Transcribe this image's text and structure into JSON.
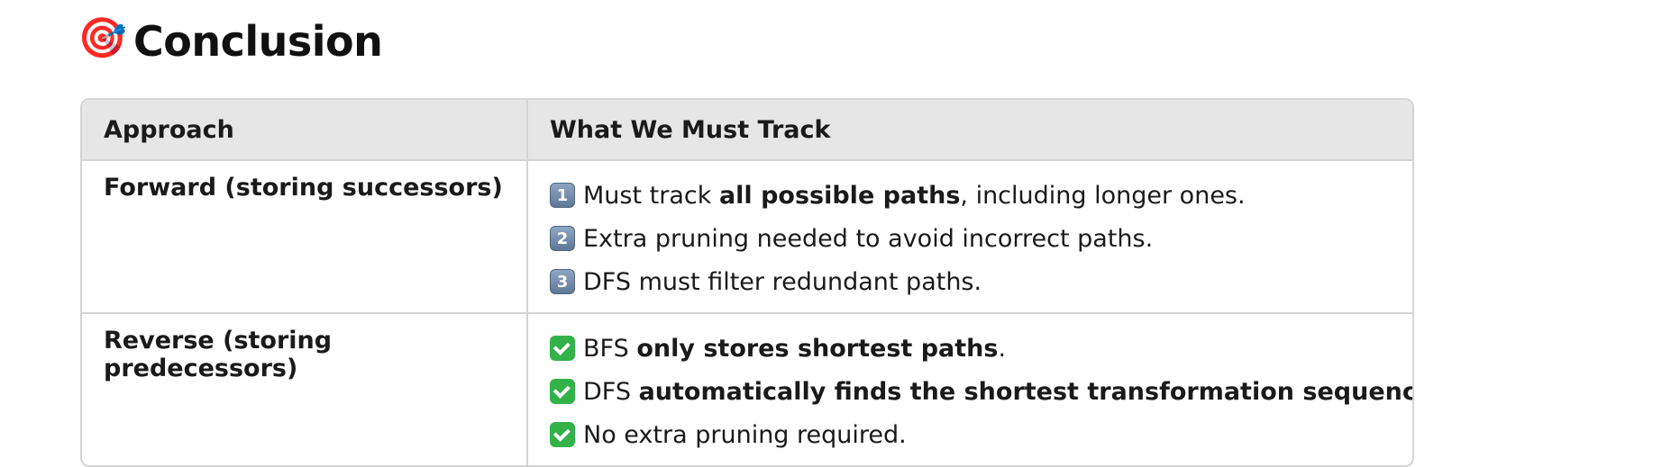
{
  "heading": {
    "icon": "direct-hit-target-icon",
    "emoji": "🎯",
    "title": "Conclusion"
  },
  "table": {
    "headers": [
      "Approach",
      "What We Must Track"
    ],
    "rows": [
      {
        "approach": "Forward (storing successors)",
        "items": [
          {
            "marker": "1",
            "pre": "Must track ",
            "bold": "all possible paths",
            "post": ", including longer ones."
          },
          {
            "marker": "2",
            "pre": "Extra pruning needed to avoid incorrect paths.",
            "bold": "",
            "post": ""
          },
          {
            "marker": "3",
            "pre": "DFS must filter redundant paths.",
            "bold": "",
            "post": ""
          }
        ]
      },
      {
        "approach": "Reverse (storing predecessors)",
        "items": [
          {
            "marker": "check",
            "pre": "BFS ",
            "bold": "only stores shortest paths",
            "post": "."
          },
          {
            "marker": "check",
            "pre": "DFS ",
            "bold": "automatically finds the shortest transformation sequences",
            "post": "."
          },
          {
            "marker": "check",
            "pre": "No extra pruning required.",
            "bold": "",
            "post": ""
          }
        ]
      }
    ]
  },
  "colors": {
    "header_bg": "#e6e6e6",
    "border": "#d4d4d4",
    "number_badge": "#6f87a6",
    "check_badge": "#34b24a"
  }
}
